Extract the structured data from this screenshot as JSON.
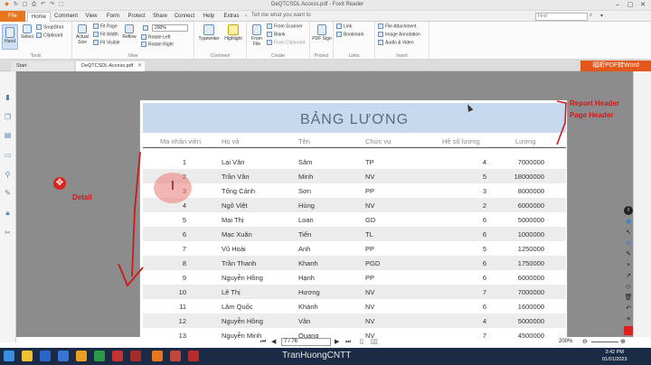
{
  "window": {
    "title": "DeQTCSDL Access.pdf - Foxit Reader"
  },
  "quick_access": [
    "↻",
    "▢",
    "⎙",
    "↶",
    "↷",
    "⬚"
  ],
  "ribbon_tabs": [
    {
      "label": "File"
    },
    {
      "label": "Home"
    },
    {
      "label": "Comment"
    },
    {
      "label": "View"
    },
    {
      "label": "Form"
    },
    {
      "label": "Protect"
    },
    {
      "label": "Share"
    },
    {
      "label": "Connect"
    },
    {
      "label": "Help"
    },
    {
      "label": "Extras"
    }
  ],
  "tell_me": "Tell me what you want to",
  "search": {
    "placeholder": "Find"
  },
  "ribbon": {
    "hand": "Hand",
    "select": "Select",
    "snapshot": "SnapShot",
    "clipboard": "Clipboard",
    "actual_size": "Actual Size",
    "fit_page": "Fit Page",
    "fit_width": "Fit Width",
    "fit_visible": "Fit Visible",
    "reflow": "Reflow",
    "zoom": "200%",
    "rotate_left": "Rotate Left",
    "rotate_right": "Rotate Right",
    "typewriter": "Typewriter",
    "highlight": "Highlight",
    "from_file": "From File",
    "from_scanner": "From Scanner",
    "blank": "Blank",
    "from_clipboard": "From Clipboard",
    "pdf_sign": "PDF Sign",
    "link": "Link",
    "bookmark": "Bookmark",
    "file_attachment": "File Attachment",
    "image_annotation": "Image Annotation",
    "audio_video": "Audio & Video",
    "groups": {
      "tools": "Tools",
      "view": "View",
      "comment": "Comment",
      "create": "Create",
      "protect": "Protect",
      "links": "Links",
      "insert": "Insert"
    }
  },
  "doc_tabs": {
    "start": "Start",
    "file": "DeQTCSDL Access.pdf"
  },
  "promo": "福昕PDF转Word",
  "report": {
    "title": "BẢNG LƯƠNG",
    "columns": [
      "Ma nhân viên",
      "Họ và",
      "Tên",
      "Chức vụ",
      "Hệ số lương",
      "Lương"
    ],
    "rows": [
      [
        "1",
        "Lại Văn",
        "Sâm",
        "TP",
        "4",
        "7000000"
      ],
      [
        "2",
        "Trần Văn",
        "Minh",
        "NV",
        "5",
        "18000000"
      ],
      [
        "3",
        "Tống Cảnh",
        "Sơn",
        "PP",
        "3",
        "8000000"
      ],
      [
        "4",
        "Ngô Việt",
        "Hùng",
        "NV",
        "2",
        "6000000"
      ],
      [
        "5",
        "Mai Thị",
        "Loan",
        "GD",
        "6",
        "5000000"
      ],
      [
        "6",
        "Mạc Xuân",
        "Tiến",
        "TL",
        "6",
        "1000000"
      ],
      [
        "7",
        "Vũ Hoài",
        "Anh",
        "PP",
        "5",
        "1250000"
      ],
      [
        "8",
        "Trần Thanh",
        "Khanh",
        "PGD",
        "6",
        "1750000"
      ],
      [
        "9",
        "Nguyễn Hồng",
        "Hạnh",
        "PP",
        "6",
        "6000000"
      ],
      [
        "10",
        "Lê Thị",
        "Hương",
        "NV",
        "7",
        "7000000"
      ],
      [
        "11",
        "Lâm Quốc",
        "Khánh",
        "NV",
        "6",
        "1600000"
      ],
      [
        "12",
        "Nguyễn Hồng",
        "Vân",
        "NV",
        "4",
        "5000000"
      ],
      [
        "13",
        "Nguyễn Minh",
        "Quang",
        "NV",
        "7",
        "4500000"
      ]
    ]
  },
  "annotations": {
    "report_header": "Report Header",
    "page_header": "Page Header",
    "detail": "Detail"
  },
  "nav": {
    "page": "7 / 76"
  },
  "status": {
    "zoom": "200%"
  },
  "taskbar": {
    "watermark": "TranHuongCNTT",
    "time": "3:42 PM",
    "date": "01/01/2023"
  },
  "colors": {
    "accent": "#e8761e",
    "header_band": "#c6d9ef",
    "annotation": "#cc1b1b"
  }
}
